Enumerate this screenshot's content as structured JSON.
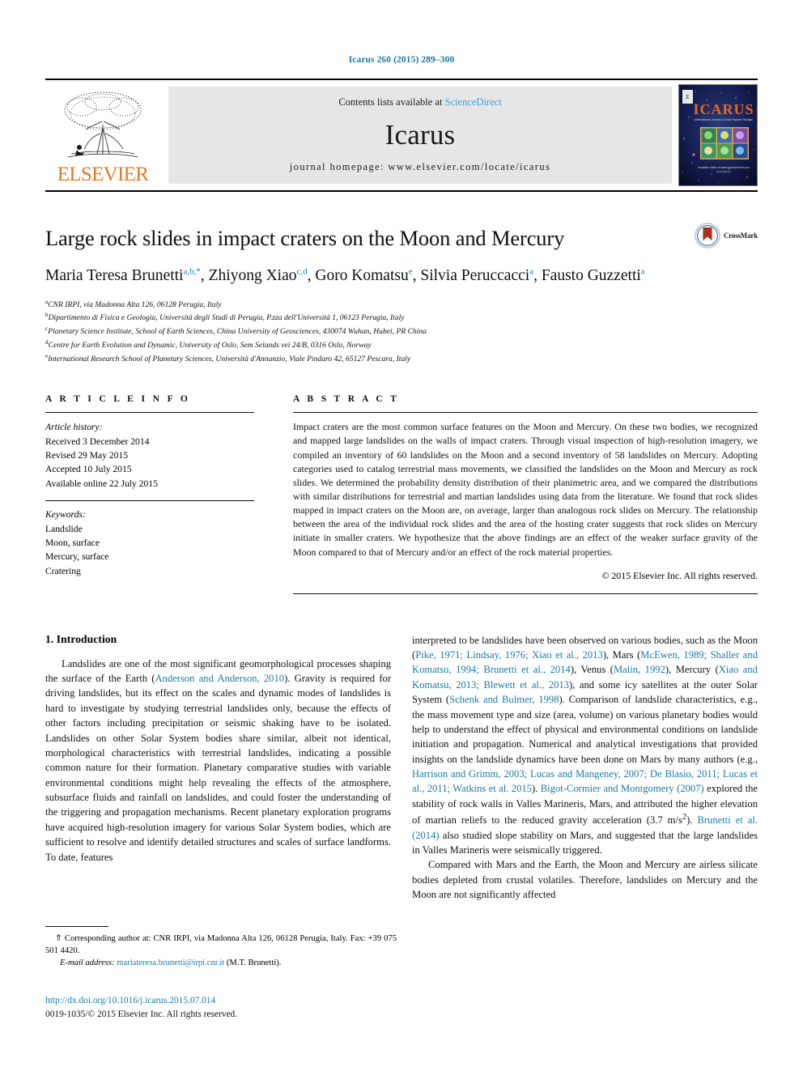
{
  "running_head": "Icarus 260 (2015) 289–300",
  "masthead": {
    "publisher_name": "ELSEVIER",
    "contents_prefix": "Contents lists available at",
    "contents_link": "ScienceDirect",
    "journal_name": "Icarus",
    "homepage_line": "journal homepage: www.elsevier.com/locate/icarus",
    "cover_title": "ICARUS",
    "cover_subtitle": "International Journal of Solar System Studies",
    "cover_footer": "Available online at\nwww.sciencedirect.com"
  },
  "article": {
    "title": "Large rock slides in impact craters on the Moon and Mercury",
    "crossmark_label": "CrossMark",
    "authors": [
      {
        "name": "Maria Teresa Brunetti",
        "marks": "a,b,*"
      },
      {
        "name": "Zhiyong Xiao",
        "marks": "c,d"
      },
      {
        "name": "Goro Komatsu",
        "marks": "e"
      },
      {
        "name": "Silvia Peruccacci",
        "marks": "a"
      },
      {
        "name": "Fausto Guzzetti",
        "marks": "a"
      }
    ],
    "affiliations": [
      {
        "mark": "a",
        "text": "CNR IRPI, via Madonna Alta 126, 06128 Perugia, Italy"
      },
      {
        "mark": "b",
        "text": "Dipartimento di Fisica e Geologia, Università degli Studi di Perugia, P.zza dell'Università 1, 06123 Perugia, Italy"
      },
      {
        "mark": "c",
        "text": "Planetary Science Institute, School of Earth Sciences, China University of Geosciences, 430074 Wuhan, Hubei, PR China"
      },
      {
        "mark": "d",
        "text": "Centre for Earth Evolution and Dynamic, University of Oslo, Sem Selands vei 24/B, 0316 Oslo, Norway"
      },
      {
        "mark": "e",
        "text": "International Research School of Planetary Sciences, Università d'Annunzio, Viale Pindaro 42, 65127 Pescara, Italy"
      }
    ]
  },
  "article_info": {
    "heading": "A R T I C L E    I N F O",
    "history_label": "Article history:",
    "history": [
      "Received 3 December 2014",
      "Revised 29 May 2015",
      "Accepted 10 July 2015",
      "Available online 22 July 2015"
    ],
    "keywords_label": "Keywords:",
    "keywords": [
      "Landslide",
      "Moon, surface",
      "Mercury, surface",
      "Cratering"
    ]
  },
  "abstract": {
    "heading": "A B S T R A C T",
    "text": "Impact craters are the most common surface features on the Moon and Mercury. On these two bodies, we recognized and mapped large landslides on the walls of impact craters. Through visual inspection of high-resolution imagery, we compiled an inventory of 60 landslides on the Moon and a second inventory of 58 landslides on Mercury. Adopting categories used to catalog terrestrial mass movements, we classified the landslides on the Moon and Mercury as rock slides. We determined the probability density distribution of their planimetric area, and we compared the distributions with similar distributions for terrestrial and martian landslides using data from the literature. We found that rock slides mapped in impact craters on the Moon are, on average, larger than analogous rock slides on Mercury. The relationship between the area of the individual rock slides and the area of the hosting crater suggests that rock slides on Mercury initiate in smaller craters. We hypothesize that the above findings are an effect of the weaker surface gravity of the Moon compared to that of Mercury and/or an effect of the rock material properties.",
    "copyright": "© 2015 Elsevier Inc. All rights reserved."
  },
  "body": {
    "section_number_title": "1. Introduction",
    "left_paragraphs": [
      "Landslides are one of the most significant geomorphological processes shaping the surface of the Earth (Anderson and Anderson, 2010). Gravity is required for driving landslides, but its effect on the scales and dynamic modes of landslides is hard to investigate by studying terrestrial landslides only, because the effects of other factors including precipitation or seismic shaking have to be isolated. Landslides on other Solar System bodies share similar, albeit not identical, morphological characteristics with terrestrial landslides, indicating a possible common nature for their formation. Planetary comparative studies with variable environmental conditions might help revealing the effects of the atmosphere, subsurface fluids and rainfall on landslides, and could foster the understanding of the triggering and propagation mechanisms. Recent planetary exploration programs have acquired high-resolution imagery for various Solar System bodies, which are sufficient to resolve and identify detailed structures and scales of surface landforms. To date, features"
    ],
    "right_paragraphs": [
      "interpreted to be landslides have been observed on various bodies, such as the Moon (Pike, 1971; Lindsay, 1976; Xiao et al., 2013), Mars (McEwen, 1989; Shaller and Komatsu, 1994; Brunetti et al., 2014), Venus (Malin, 1992), Mercury (Xiao and Komatsu, 2013; Blewett et al., 2013), and some icy satellites at the outer Solar System (Schenk and Bulmer, 1998). Comparison of landslide characteristics, e.g., the mass movement type and size (area, volume) on various planetary bodies would help to understand the effect of physical and environmental conditions on landslide initiation and propagation. Numerical and analytical investigations that provided insights on the landslide dynamics have been done on Mars by many authors (e.g., Harrison and Grimm, 2003; Lucas and Mangeney, 2007; De Blasio, 2011; Lucas et al., 2011; Watkins et al. 2015). Bigot-Cormier and Montgomery (2007) explored the stability of rock walls in Valles Marineris, Mars, and attributed the higher elevation of martian reliefs to the reduced gravity acceleration (3.7 m/s²). Brunetti et al. (2014) also studied slope stability on Mars, and suggested that the large landslides in Valles Marineris were seismically triggered.",
      "Compared with Mars and the Earth, the Moon and Mercury are airless silicate bodies depleted from crustal volatiles. Therefore, landslides on Mercury and the Moon are not significantly affected"
    ]
  },
  "footnotes": {
    "corresponding_symbol": "⇑",
    "corresponding_text": "Corresponding author at: CNR IRPI, via Madonna Alta 126, 06128 Perugia, Italy. Fax: +39 075 501 4420.",
    "email_label": "E-mail address:",
    "email": "mariateresa.brunetti@irpi.cnr.it",
    "email_suffix": "(M.T. Brunetti)."
  },
  "doi": {
    "url": "http://dx.doi.org/10.1016/j.icarus.2015.07.014",
    "issn": "0019-1035/© 2015 Elsevier Inc. All rights reserved."
  },
  "colors": {
    "link": "#1a7aa8",
    "elsevier_orange": "#E87722",
    "science_direct": "#3fa0d8",
    "band_gray": "#e6e6e6"
  }
}
